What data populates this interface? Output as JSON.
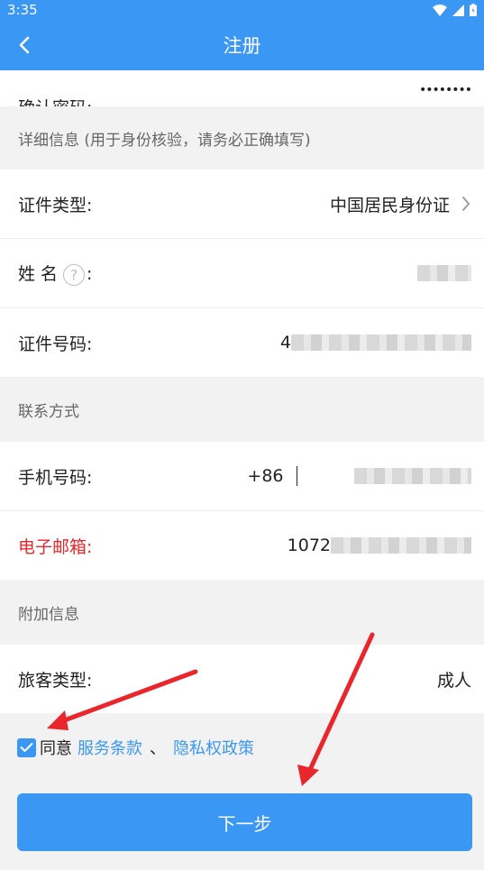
{
  "status_bar": {
    "time": "3:35"
  },
  "nav": {
    "title": "注册"
  },
  "partial_row": {
    "label": "确认密码:",
    "value": "••••••••"
  },
  "details_section": {
    "header": "详细信息 (用于身份核验，请务必正确填写)"
  },
  "id_type": {
    "label": "证件类型:",
    "value": "中国居民身份证"
  },
  "name": {
    "label_part1": "姓 名",
    "help": "?",
    "label_part2": ":"
  },
  "id_number": {
    "label": "证件号码:",
    "prefix": "4"
  },
  "contact_section": {
    "header": "联系方式"
  },
  "phone": {
    "label": "手机号码:",
    "country_code": "+86"
  },
  "email": {
    "label": "电子邮箱:",
    "prefix": "1072"
  },
  "extra_section": {
    "header": "附加信息"
  },
  "passenger_type": {
    "label": "旅客类型:",
    "value": "成人"
  },
  "agreement": {
    "prefix": "同意",
    "terms_link": "服务条款",
    "separator": "、",
    "privacy_link": "隐私权政策"
  },
  "next_button": {
    "label": "下一步"
  },
  "colors": {
    "primary": "#3b97f4",
    "required": "#e8262b",
    "annotation_arrow": "#e8262b"
  }
}
